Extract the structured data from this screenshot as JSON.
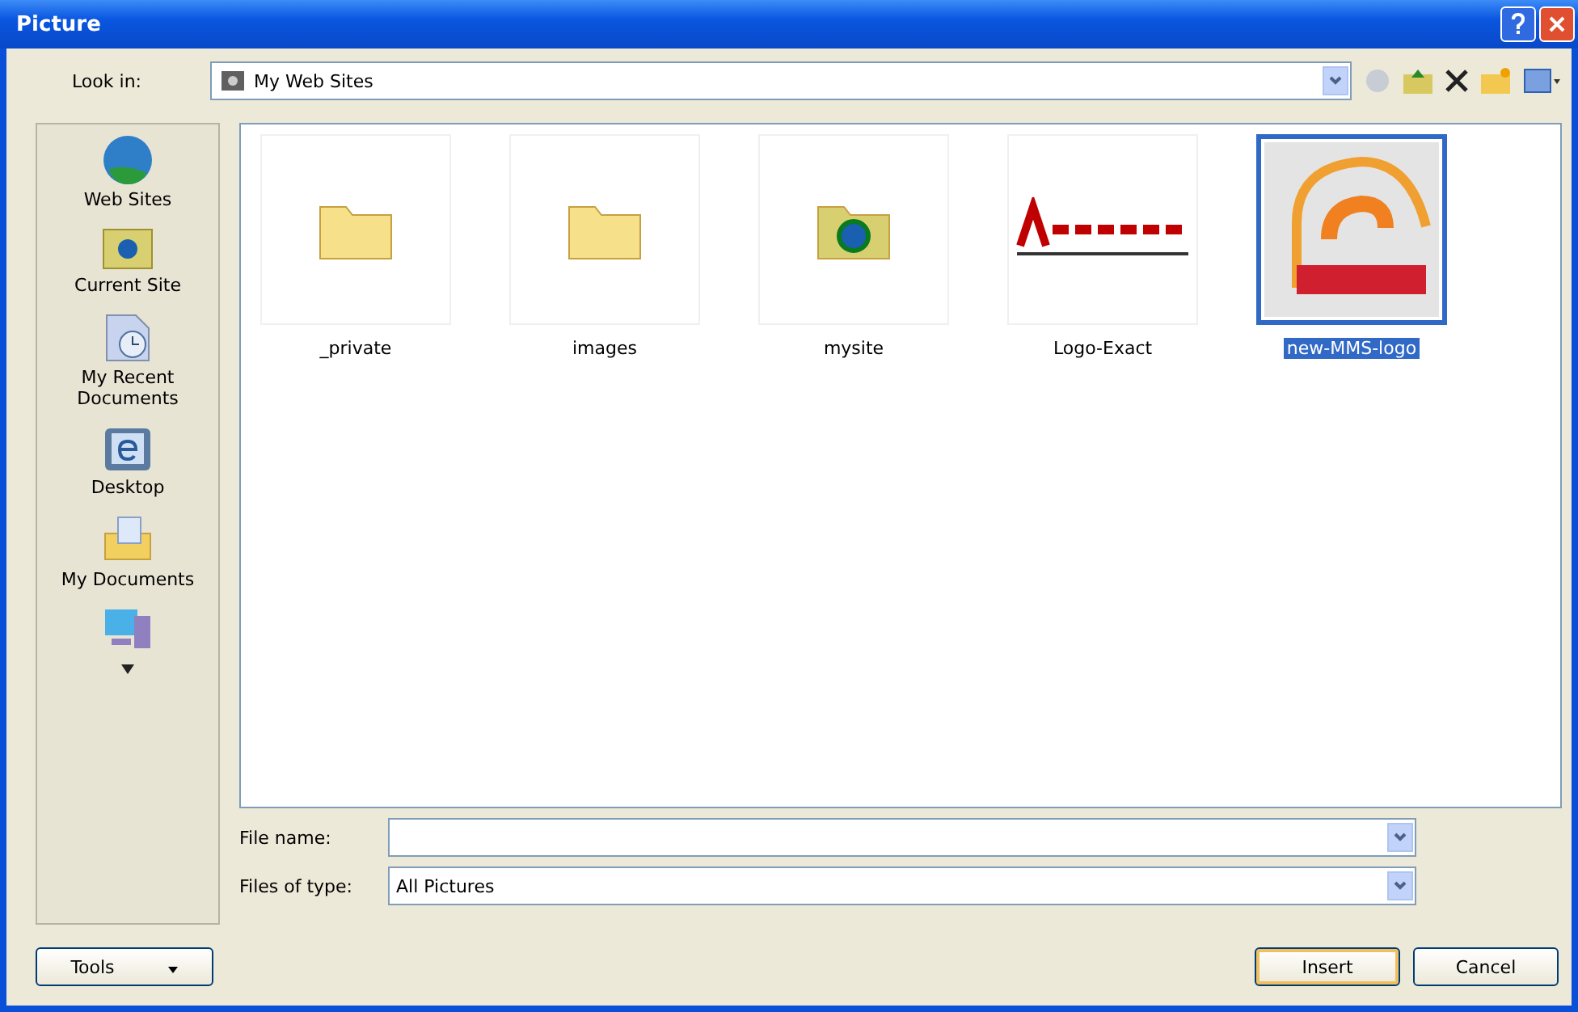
{
  "window": {
    "title": "Picture"
  },
  "look_in": {
    "label": "Look in:",
    "value": "My Web Sites"
  },
  "sidebar": {
    "items": [
      {
        "label": "Web Sites",
        "kind": "globe"
      },
      {
        "label": "Current Site",
        "kind": "webfolder"
      },
      {
        "label": "My Recent Documents",
        "kind": "recent"
      },
      {
        "label": "Desktop",
        "kind": "desktop"
      },
      {
        "label": "My Documents",
        "kind": "documents"
      },
      {
        "kind": "computer"
      }
    ]
  },
  "files": [
    {
      "name": "_private",
      "kind": "folder",
      "selected": false
    },
    {
      "name": "images",
      "kind": "folder",
      "selected": false
    },
    {
      "name": "mysite",
      "kind": "webfolder",
      "selected": false
    },
    {
      "name": "Logo-Exact",
      "kind": "logo-text",
      "selected": false
    },
    {
      "name": "new-MMS-logo",
      "kind": "logo-emblem",
      "selected": true
    }
  ],
  "file_name": {
    "label": "File name:"
  },
  "file_type": {
    "label": "Files of type:",
    "value": "All Pictures"
  },
  "buttons": {
    "tools": "Tools",
    "insert": "Insert",
    "cancel": "Cancel"
  }
}
